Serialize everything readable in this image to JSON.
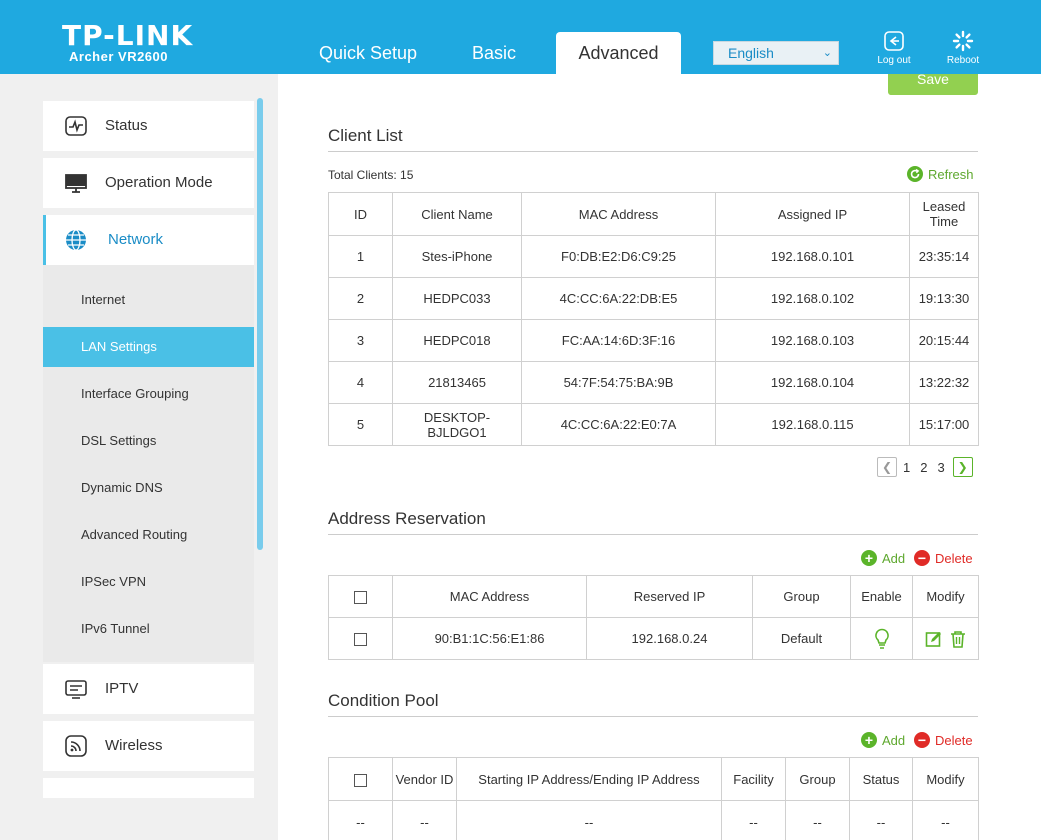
{
  "header": {
    "brand": "TP-LINK",
    "model": "Archer VR2600",
    "tabs": [
      "Quick Setup",
      "Basic",
      "Advanced"
    ],
    "language": "English",
    "logout_label": "Log out",
    "reboot_label": "Reboot",
    "brand_color": "#1fa9e0"
  },
  "sidebar": {
    "items": [
      {
        "label": "Status",
        "icon": "pulse-icon"
      },
      {
        "label": "Operation Mode",
        "icon": "monitor-icon"
      },
      {
        "label": "Network",
        "icon": "globe-icon"
      },
      {
        "label": "IPTV",
        "icon": "tv-icon"
      },
      {
        "label": "Wireless",
        "icon": "wifi-icon"
      }
    ],
    "sub_items": [
      "Internet",
      "LAN Settings",
      "Interface Grouping",
      "DSL Settings",
      "Dynamic DNS",
      "Advanced Routing",
      "IPSec VPN",
      "IPv6 Tunnel"
    ],
    "active_sub": "LAN Settings"
  },
  "main": {
    "save_label": "Save",
    "client_list": {
      "title": "Client List",
      "total_label": "Total Clients: 15",
      "refresh_label": "Refresh",
      "headers": [
        "ID",
        "Client Name",
        "MAC Address",
        "Assigned IP",
        "Leased Time"
      ],
      "rows": [
        [
          "1",
          "Stes-iPhone",
          "F0:DB:E2:D6:C9:25",
          "192.168.0.101",
          "23:35:14"
        ],
        [
          "2",
          "HEDPC033",
          "4C:CC:6A:22:DB:E5",
          "192.168.0.102",
          "19:13:30"
        ],
        [
          "3",
          "HEDPC018",
          "FC:AA:14:6D:3F:16",
          "192.168.0.103",
          "20:15:44"
        ],
        [
          "4",
          "21813465",
          "54:7F:54:75:BA:9B",
          "192.168.0.104",
          "13:22:32"
        ],
        [
          "5",
          "DESKTOP-BJLDGO1",
          "4C:CC:6A:22:E0:7A",
          "192.168.0.115",
          "15:17:00"
        ]
      ],
      "pages": [
        "1",
        "2",
        "3"
      ]
    },
    "address_reservation": {
      "title": "Address Reservation",
      "add_label": "Add",
      "delete_label": "Delete",
      "headers": [
        "MAC Address",
        "Reserved IP",
        "Group",
        "Enable",
        "Modify"
      ],
      "rows": [
        {
          "mac": "90:B1:1C:56:E1:86",
          "ip": "192.168.0.24",
          "group": "Default"
        }
      ]
    },
    "condition_pool": {
      "title": "Condition Pool",
      "add_label": "Add",
      "delete_label": "Delete",
      "headers": [
        "Vendor ID",
        "Starting IP Address/Ending IP Address",
        "Facility",
        "Group",
        "Status",
        "Modify"
      ],
      "rows": [
        [
          "--",
          "--",
          "--",
          "--",
          "--",
          "--",
          "--"
        ]
      ]
    }
  }
}
